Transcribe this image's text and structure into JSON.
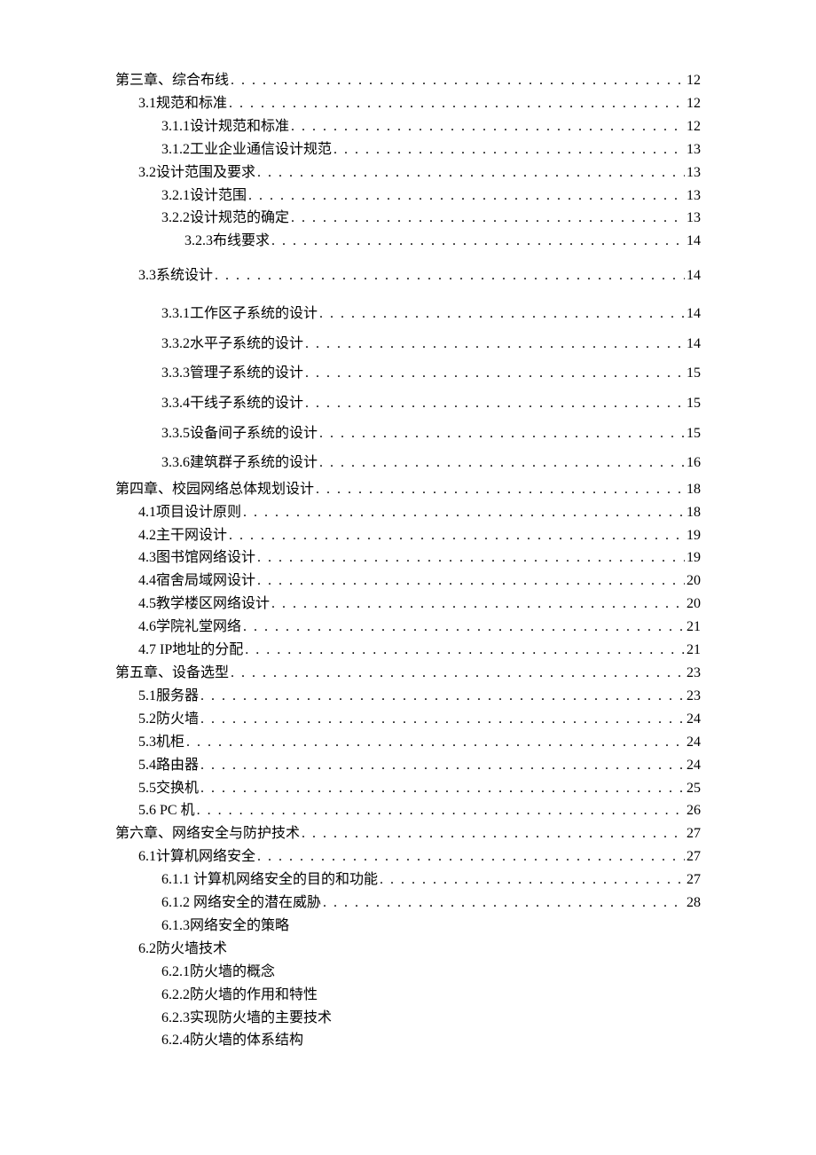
{
  "toc": [
    {
      "level": 1,
      "title": "第三章、综合布线 ",
      "page": "12",
      "spaced": true
    },
    {
      "level": 2,
      "title": "3.1规范和标准",
      "page": "12"
    },
    {
      "level": 3,
      "title": "3.1.1设计规范和标准 ",
      "page": "12"
    },
    {
      "level": 3,
      "title": "3.1.2工业企业通信设计规范 ",
      "page": "13"
    },
    {
      "level": 2,
      "title": "3.2设计范围及要求",
      "page": "13"
    },
    {
      "level": 3,
      "title": "3.2.1设计范围 ",
      "page": "13"
    },
    {
      "level": 3,
      "title": "3.2.2设计规范的确定 ",
      "page": "13"
    },
    {
      "level": 4,
      "title": "3.2.3布线要求 ",
      "page": "14"
    },
    {
      "level": 2,
      "title": "3.3系统设计",
      "page": "14",
      "gapAbove": true
    },
    {
      "level": 3,
      "title": "3.3.1工作区子系统的设计 ",
      "page": "14",
      "tall": true,
      "gapAbove": true
    },
    {
      "level": 3,
      "title": "3.3.2水平子系统的设计 ",
      "page": "14",
      "tall": true
    },
    {
      "level": 3,
      "title": "3.3.3管理子系统的设计 ",
      "page": "15",
      "tall": true
    },
    {
      "level": 3,
      "title": "3.3.4干线子系统的设计 ",
      "page": "15",
      "tall": true
    },
    {
      "level": 3,
      "title": "3.3.5设备间子系统的设计 ",
      "page": "15",
      "tall": true
    },
    {
      "level": 3,
      "title": "3.3.6建筑群子系统的设计 ",
      "page": "16",
      "tall": true
    },
    {
      "level": 1,
      "title": "第四章、校园网络总体规划设计 ",
      "page": "18",
      "spaced": true
    },
    {
      "level": 2,
      "title": "4.1项目设计原则",
      "page": "18"
    },
    {
      "level": 2,
      "title": "4.2主干网设计",
      "page": "19"
    },
    {
      "level": 2,
      "title": "4.3图书馆网络设计",
      "page": "19"
    },
    {
      "level": 2,
      "title": "4.4宿舍局域网设计",
      "page": "20"
    },
    {
      "level": 2,
      "title": "4.5教学楼区网络设计",
      "page": "20"
    },
    {
      "level": 2,
      "title": "4.6学院礼堂网络",
      "page": "21"
    },
    {
      "level": 2,
      "title": "4.7 IP地址的分配",
      "page": "21"
    },
    {
      "level": 1,
      "title": "第五章、设备选型 ",
      "page": "23",
      "spaced": true
    },
    {
      "level": 2,
      "title": "5.1服务器",
      "page": "23"
    },
    {
      "level": 2,
      "title": "5.2防火墙",
      "page": "24"
    },
    {
      "level": 2,
      "title": "5.3机柜",
      "page": "24"
    },
    {
      "level": 2,
      "title": "5.4路由器",
      "page": "24"
    },
    {
      "level": 2,
      "title": "5.5交换机",
      "page": "25"
    },
    {
      "level": 2,
      "title": "5.6 PC 机",
      "page": "26"
    },
    {
      "level": 1,
      "title": "第六章、网络安全与防护技术 ",
      "page": "27",
      "spaced": true
    },
    {
      "level": 2,
      "title": "6.1计算机网络安全",
      "page": "27"
    },
    {
      "level": 3,
      "title": "6.1.1  计算机网络安全的目的和功能",
      "page": "27"
    },
    {
      "level": 3,
      "title": "6.1.2  网络安全的潜在威胁",
      "page": "28"
    },
    {
      "level": 3,
      "title": "6.1.3网络安全的策略",
      "page": "",
      "noPage": true
    },
    {
      "level": 2,
      "title": "6.2防火墙技术",
      "page": "",
      "noPage": true
    },
    {
      "level": 3,
      "title": "6.2.1防火墙的概念",
      "page": "",
      "noPage": true
    },
    {
      "level": 3,
      "title": "6.2.2防火墙的作用和特性",
      "page": "",
      "noPage": true
    },
    {
      "level": 3,
      "title": "6.2.3实现防火墙的主要技术",
      "page": "",
      "noPage": true
    },
    {
      "level": 3,
      "title": "6.2.4防火墙的体系结构",
      "page": "",
      "noPage": true
    }
  ]
}
